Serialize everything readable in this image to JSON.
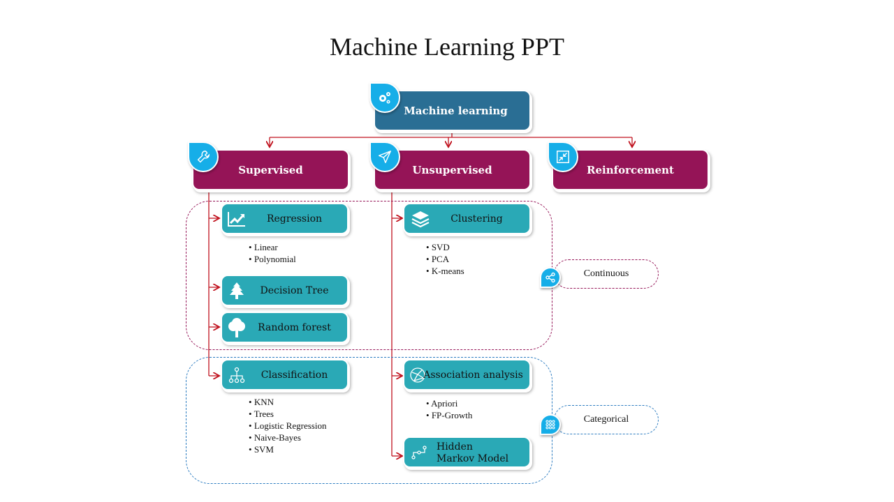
{
  "title": "Machine Learning PPT",
  "root": {
    "label": "Machine learning",
    "icon": "gears-icon"
  },
  "categories": [
    {
      "label": "Supervised",
      "icon": "wrench-icon"
    },
    {
      "label": "Unsupervised",
      "icon": "paper-plane-icon"
    },
    {
      "label": "Reinforcement",
      "icon": "collapse-arrows-icon"
    }
  ],
  "supervised": {
    "regression": {
      "label": "Regression",
      "icon": "line-chart-icon",
      "items": [
        "Linear",
        "Polynomial"
      ]
    },
    "decision_tree": {
      "label": "Decision Tree",
      "icon": "pine-tree-icon"
    },
    "random_forest": {
      "label": "Random forest",
      "icon": "tree-icon"
    },
    "classification": {
      "label": "Classification",
      "icon": "hierarchy-icon",
      "items": [
        "KNN",
        "Trees",
        "Logistic Regression",
        "Naive-Bayes",
        "SVM"
      ]
    }
  },
  "unsupervised": {
    "clustering": {
      "label": "Clustering",
      "icon": "layers-icon",
      "items": [
        "SVD",
        "PCA",
        "K-means"
      ]
    },
    "association": {
      "label": "Association analysis",
      "icon": "network-globe-icon",
      "items": [
        "Apriori",
        "FP-Growth"
      ]
    },
    "hmm": {
      "label_line1": "Hidden",
      "label_line2": "Markov Model",
      "icon": "path-nodes-icon"
    }
  },
  "legend": {
    "continuous": {
      "label": "Continuous",
      "icon": "share-icon",
      "color": "#951457"
    },
    "categorical": {
      "label": "Categorical",
      "icon": "dot-grid-icon",
      "color": "#2a7bc0"
    }
  },
  "colors": {
    "root": "#2a6e94",
    "category": "#951457",
    "algorithm": "#2aa9b6",
    "badge": "#16aee8",
    "connector": "#c0121e"
  }
}
